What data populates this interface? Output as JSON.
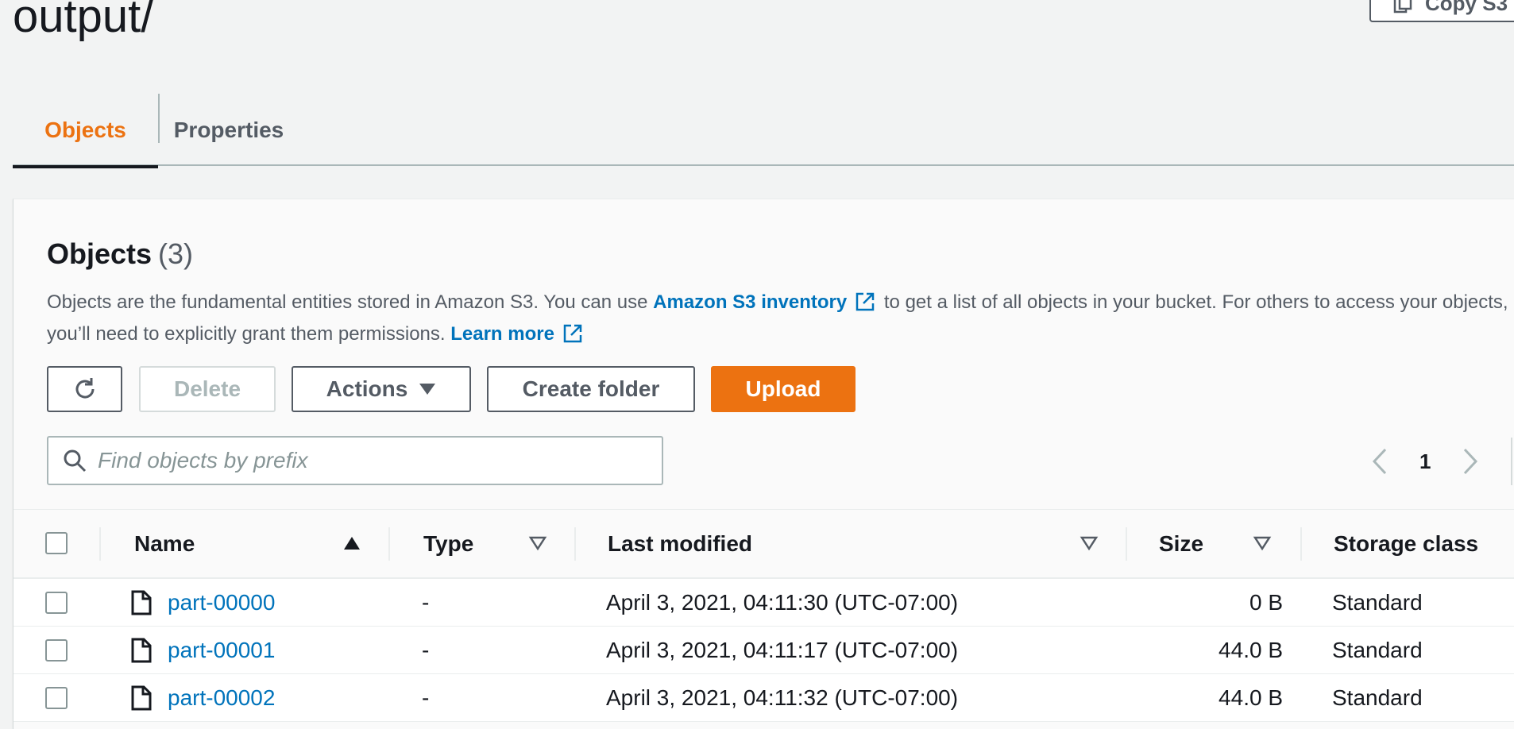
{
  "page": {
    "title": "output/",
    "copy_button_label": "Copy S3"
  },
  "tabs": [
    {
      "label": "Objects",
      "active": true
    },
    {
      "label": "Properties",
      "active": false
    }
  ],
  "objects_panel": {
    "heading": "Objects",
    "count": "(3)",
    "description": {
      "part1": "Objects are the fundamental entities stored in Amazon S3. You can use",
      "link1": "Amazon S3 inventory",
      "part2": "to get a list of all objects in your bucket. For others to access your objects,",
      "part3": "you’ll need to explicitly grant them permissions.",
      "link2": "Learn more"
    },
    "toolbar": {
      "refresh_icon": "refresh-icon",
      "delete_label": "Delete",
      "actions_label": "Actions",
      "create_folder_label": "Create folder",
      "upload_label": "Upload"
    },
    "search": {
      "placeholder": "Find objects by prefix",
      "value": ""
    },
    "pagination": {
      "current_page": "1"
    }
  },
  "table": {
    "columns": [
      "Name",
      "Type",
      "Last modified",
      "Size",
      "Storage class"
    ],
    "rows": [
      {
        "name": "part-00000",
        "type": "-",
        "last_modified": "April 3, 2021, 04:11:30 (UTC-07:00)",
        "size": "0 B",
        "storage_class": "Standard"
      },
      {
        "name": "part-00001",
        "type": "-",
        "last_modified": "April 3, 2021, 04:11:17 (UTC-07:00)",
        "size": "44.0 B",
        "storage_class": "Standard"
      },
      {
        "name": "part-00002",
        "type": "-",
        "last_modified": "April 3, 2021, 04:11:32 (UTC-07:00)",
        "size": "44.0 B",
        "storage_class": "Standard"
      }
    ]
  },
  "colors": {
    "accent": "#ec7211",
    "link": "#0073bb",
    "text": "#16191f",
    "muted": "#545b64"
  }
}
